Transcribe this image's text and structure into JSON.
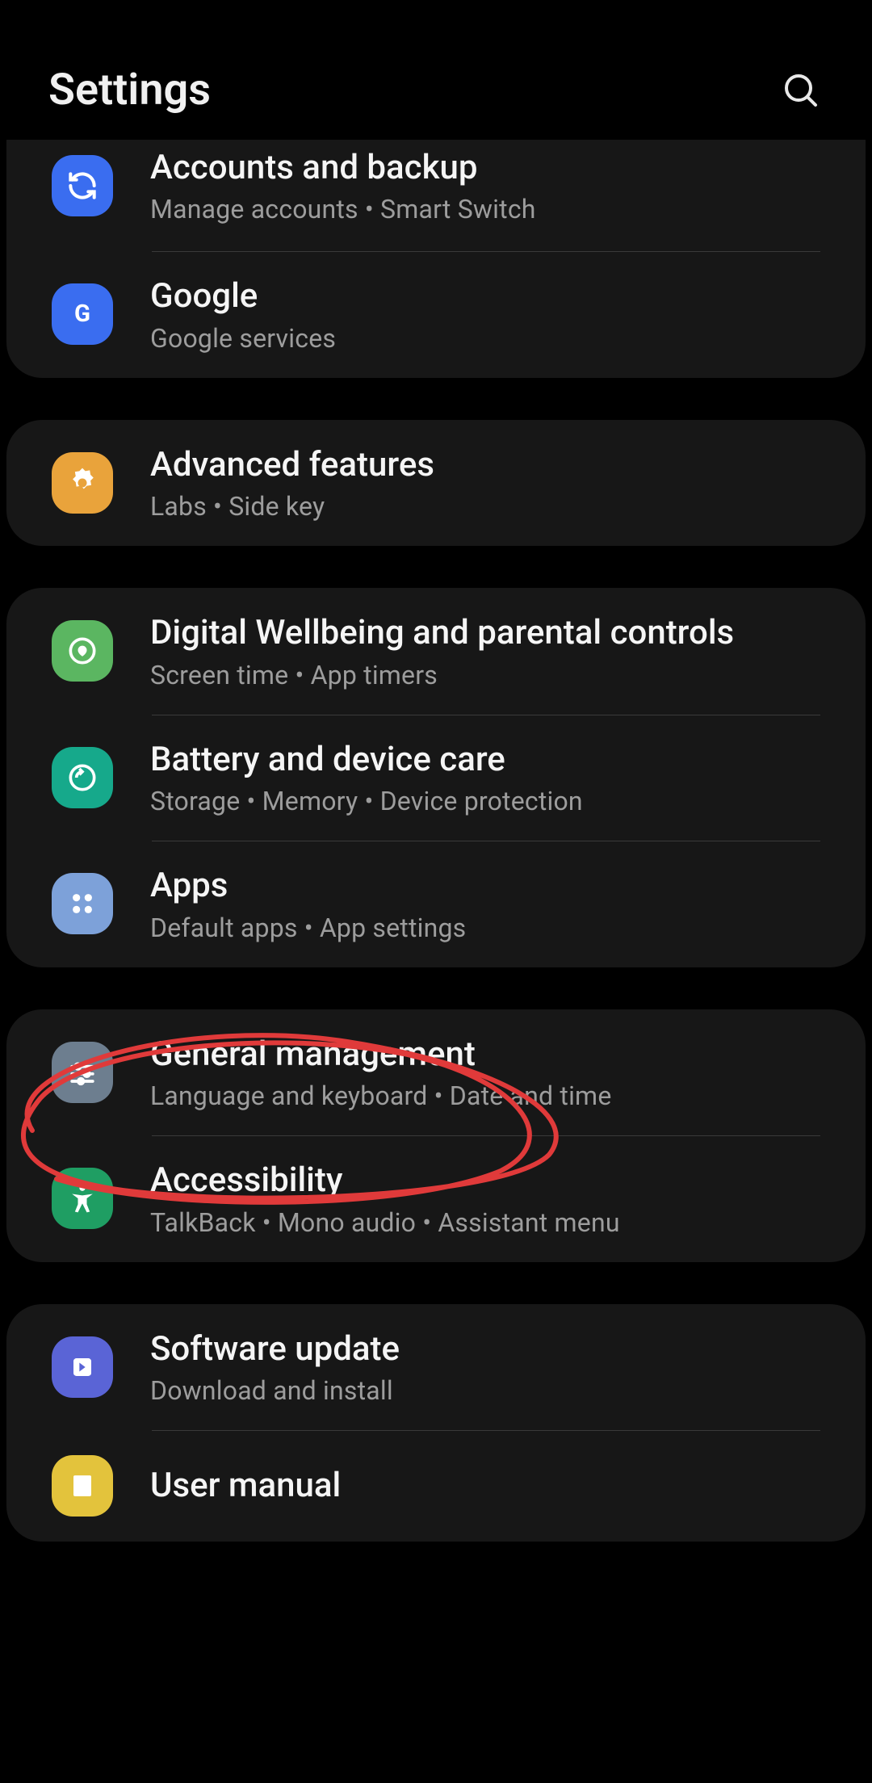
{
  "header": {
    "title": "Settings"
  },
  "groups": [
    {
      "items": [
        {
          "icon": "sync-icon",
          "icon_bg": "#3a6df0",
          "title": "Accounts and backup",
          "subtitle": "Manage accounts  •  Smart Switch"
        },
        {
          "icon": "google-icon",
          "icon_bg": "#3a6df0",
          "title": "Google",
          "subtitle": "Google services"
        }
      ]
    },
    {
      "items": [
        {
          "icon": "gear-flower-icon",
          "icon_bg": "#e9a33b",
          "title": "Advanced features",
          "subtitle": "Labs  •  Side key"
        }
      ]
    },
    {
      "items": [
        {
          "icon": "wellbeing-icon",
          "icon_bg": "#5bb661",
          "title": "Digital Wellbeing and parental controls",
          "subtitle": "Screen time  •  App timers"
        },
        {
          "icon": "battery-care-icon",
          "icon_bg": "#16a98b",
          "title": "Battery and device care",
          "subtitle": "Storage  •  Memory  •  Device protection"
        },
        {
          "icon": "apps-icon",
          "icon_bg": "#7da1d9",
          "title": "Apps",
          "subtitle": "Default apps  •  App settings"
        }
      ]
    },
    {
      "items": [
        {
          "icon": "sliders-icon",
          "icon_bg": "#6d7e8f",
          "title": "General management",
          "subtitle": "Language and keyboard  •  Date and time"
        },
        {
          "icon": "accessibility-icon",
          "icon_bg": "#1f9e63",
          "title": "Accessibility",
          "subtitle": "TalkBack  •  Mono audio  •  Assistant menu"
        }
      ]
    },
    {
      "items": [
        {
          "icon": "update-icon",
          "icon_bg": "#5a64d6",
          "title": "Software update",
          "subtitle": "Download and install"
        },
        {
          "icon": "manual-icon",
          "icon_bg": "#e3c33c",
          "title": "User manual",
          "subtitle": ""
        }
      ]
    }
  ]
}
